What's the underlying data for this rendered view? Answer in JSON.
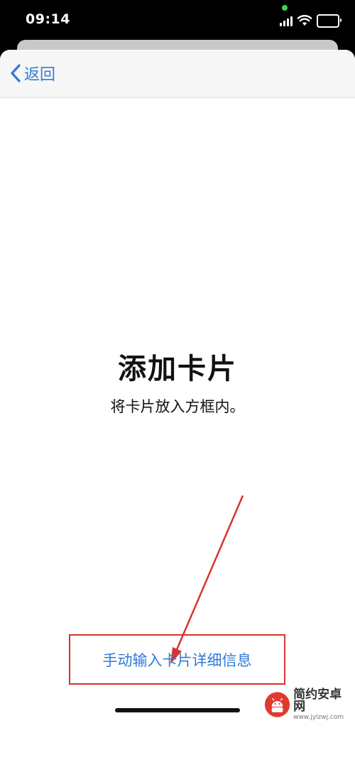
{
  "status_bar": {
    "time": "09:14"
  },
  "nav": {
    "back_label": "返回"
  },
  "main": {
    "title": "添加卡片",
    "subtitle": "将卡片放入方框内。",
    "manual_entry_label": "手动输入卡片详细信息"
  },
  "watermark": {
    "name": "简约安卓网",
    "url": "www.jylzwj.com"
  },
  "colors": {
    "accent": "#2f7bd8",
    "annotation": "#d9332e"
  }
}
